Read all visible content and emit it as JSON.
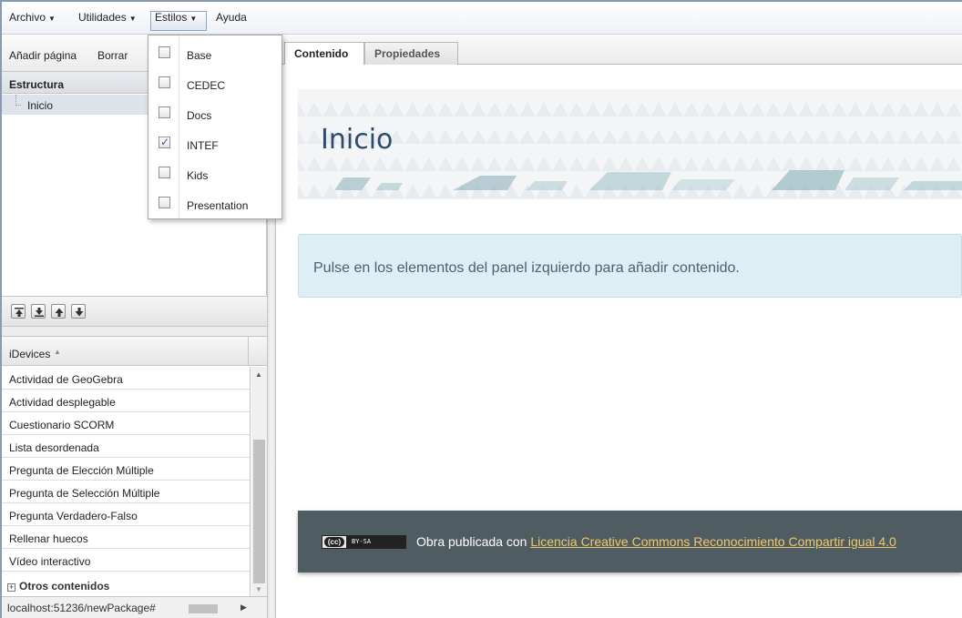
{
  "menubar": {
    "archivo": "Archivo",
    "utilidades": "Utilidades",
    "estilos": "Estilos",
    "ayuda": "Ayuda"
  },
  "left_toolbar": {
    "add_page": "Añadir página",
    "delete": "Borrar"
  },
  "structure": {
    "header": "Estructura",
    "nodes": [
      {
        "label": "Inicio"
      }
    ]
  },
  "move_buttons": [
    "move-top-icon",
    "move-bottom-icon",
    "move-up-icon",
    "move-down-icon"
  ],
  "idevices": {
    "header": "iDevices",
    "items": [
      "Actividad de GeoGebra",
      "Actividad desplegable",
      "Cuestionario SCORM",
      "Lista desordenada",
      "Pregunta de Elección Múltiple",
      "Pregunta de Selección Múltiple",
      "Pregunta Verdadero-Falso",
      "Rellenar huecos",
      "Vídeo interactivo"
    ],
    "group": "Otros contenidos"
  },
  "status": {
    "url": "localhost:51236/newPackage#"
  },
  "styles_menu": {
    "items": [
      {
        "label": "Base",
        "checked": false
      },
      {
        "label": "CEDEC",
        "checked": false
      },
      {
        "label": "Docs",
        "checked": false
      },
      {
        "label": "INTEF",
        "checked": true
      },
      {
        "label": "Kids",
        "checked": false
      },
      {
        "label": "Presentation",
        "checked": false
      }
    ]
  },
  "tabs": {
    "content": "Contenido",
    "properties": "Propiedades"
  },
  "page": {
    "title": "Inicio",
    "info": "Pulse en los elementos del panel izquierdo para añadir contenido.",
    "footer_prefix": "Obra publicada con ",
    "footer_link": "Licencia Creative Commons Reconocimiento Compartir igual 4.0",
    "cc_badge_left": "(cc)",
    "cc_badge_right": "BY-SA"
  },
  "colors": {
    "heading": "#2b4d6b",
    "info_bg": "#ddeef5",
    "footer_bg": "#4f5d63",
    "footer_link": "#f0c86a"
  }
}
